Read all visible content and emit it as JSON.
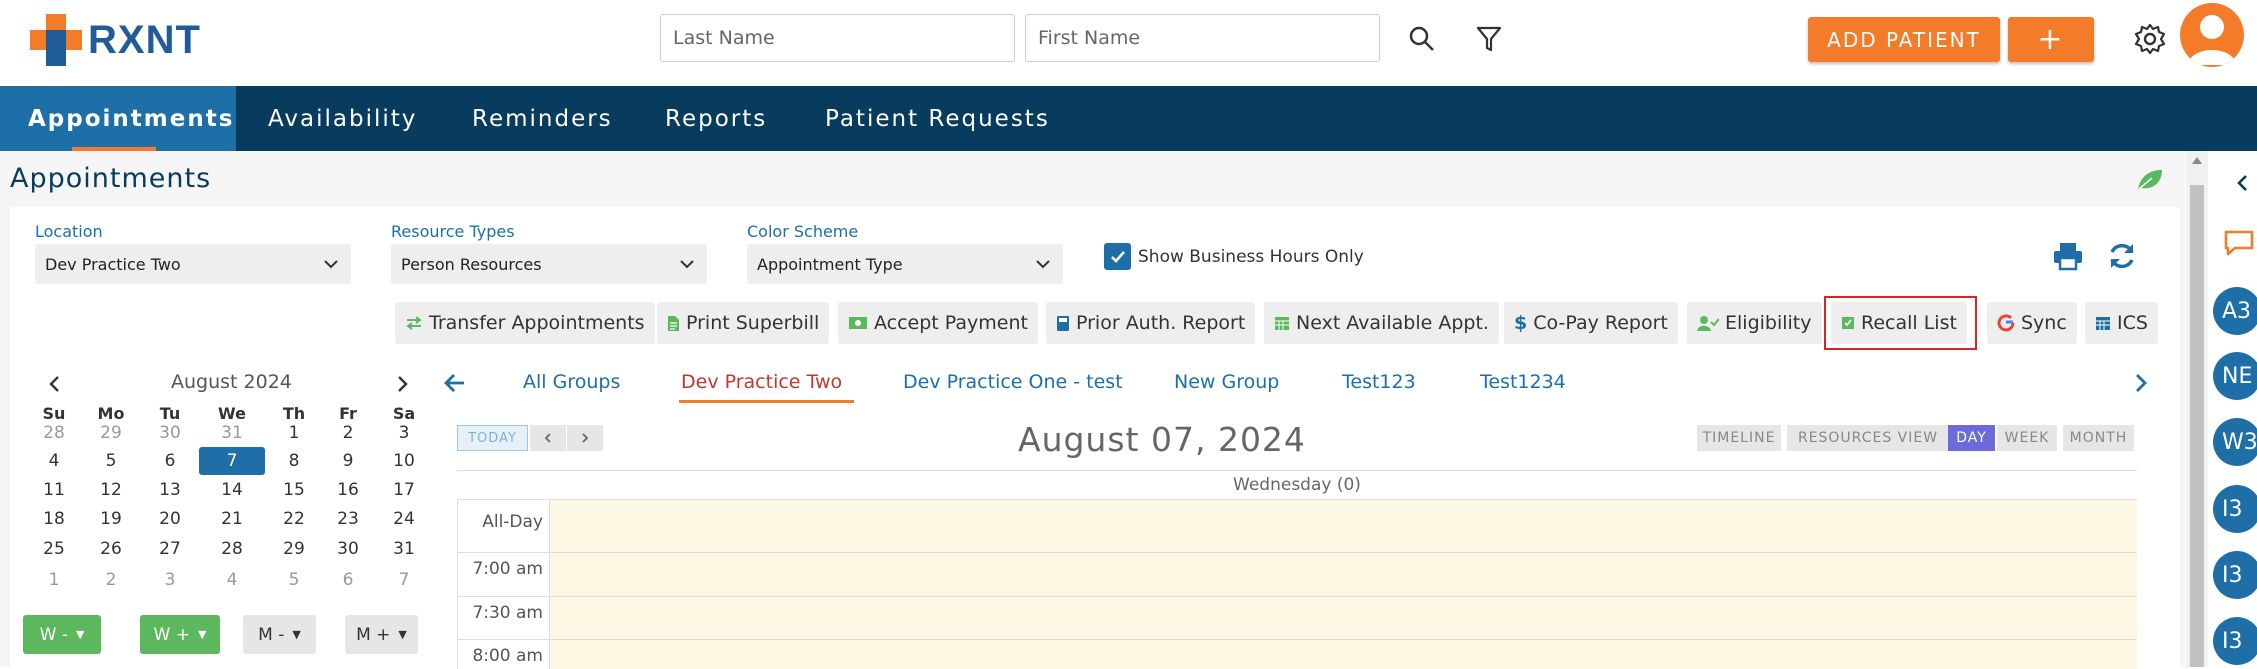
{
  "header": {
    "logo_text": "RXNT",
    "last_name_placeholder": "Last Name",
    "first_name_placeholder": "First Name",
    "add_patient_label": "ADD PATIENT",
    "plus_label": "+"
  },
  "nav": {
    "tabs": [
      {
        "label": "Appointments",
        "active": true
      },
      {
        "label": "Availability"
      },
      {
        "label": "Reminders"
      },
      {
        "label": "Reports"
      },
      {
        "label": "Patient Requests"
      }
    ]
  },
  "page": {
    "title": "Appointments"
  },
  "filters": {
    "location_label": "Location",
    "location_value": "Dev Practice Two",
    "resource_types_label": "Resource Types",
    "resource_types_value": "Person Resources",
    "color_scheme_label": "Color Scheme",
    "color_scheme_value": "Appointment Type",
    "business_hours_label": "Show Business Hours Only",
    "business_hours_checked": true
  },
  "toolbar": [
    {
      "label": "Transfer Appointments",
      "icon": "transfer-icon"
    },
    {
      "label": "Print Superbill",
      "icon": "file-icon"
    },
    {
      "label": "Accept Payment",
      "icon": "money-icon"
    },
    {
      "label": "Prior Auth. Report",
      "icon": "book-icon"
    },
    {
      "label": "Next Available Appt.",
      "icon": "calendar-icon"
    },
    {
      "label": "Co-Pay Report",
      "icon": "dollar-icon"
    },
    {
      "label": "Eligibility",
      "icon": "user-check-icon"
    },
    {
      "label": "Recall List",
      "icon": "recall-icon"
    },
    {
      "label": "Sync",
      "icon": "google-icon"
    },
    {
      "label": "ICS",
      "icon": "calendar-icon"
    }
  ],
  "mini_calendar": {
    "month": "August 2024",
    "day_headers": [
      "Su",
      "Mo",
      "Tu",
      "We",
      "Th",
      "Fr",
      "Sa"
    ],
    "weeks": [
      [
        "28",
        "29",
        "30",
        "31",
        "1",
        "2",
        "3"
      ],
      [
        "4",
        "5",
        "6",
        "7",
        "8",
        "9",
        "10"
      ],
      [
        "11",
        "12",
        "13",
        "14",
        "15",
        "16",
        "17"
      ],
      [
        "18",
        "19",
        "20",
        "21",
        "22",
        "23",
        "24"
      ],
      [
        "25",
        "26",
        "27",
        "28",
        "29",
        "30",
        "31"
      ],
      [
        "1",
        "2",
        "3",
        "4",
        "5",
        "6",
        "7"
      ]
    ],
    "selected_day": "7",
    "buttons": [
      "W -",
      "W +",
      "M -",
      "M +"
    ]
  },
  "groups": {
    "tabs": [
      "All Groups",
      "Dev Practice Two",
      "Dev Practice One - test",
      "New Group",
      "Test123",
      "Test1234"
    ],
    "active": "Dev Practice Two"
  },
  "scheduler": {
    "today_label": "TODAY",
    "date_title": "August 07, 2024",
    "views": [
      "TIMELINE",
      "RESOURCES VIEW",
      "DAY",
      "WEEK",
      "MONTH"
    ],
    "active_view": "DAY",
    "column_header": "Wednesday (0)",
    "all_day_label": "All-Day",
    "times": [
      "7:00 am",
      "7:30 am",
      "8:00 am"
    ]
  },
  "right_sidebar": {
    "bubbles": [
      "A3",
      "NE",
      "W3",
      "I3",
      "I3",
      "I3"
    ]
  },
  "colors": {
    "brand_blue": "#1f5c99",
    "nav_bg": "#073c5f",
    "accent_orange": "#f47b2a",
    "recall_highlight": "#d9252a"
  }
}
